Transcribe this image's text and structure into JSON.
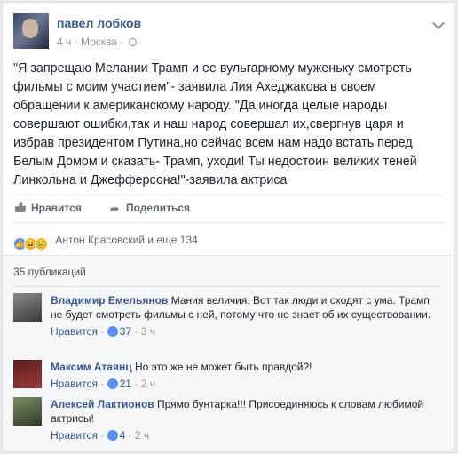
{
  "post": {
    "author": "павел лобков",
    "time": "4 ч",
    "location": "Москва",
    "text": "\"Я запрещаю Мелании Трамп и ее вульгарному муженьку смотреть фильмы с моим участием\"- заявила Лия Ахеджакова в своем обращении к американскому народу. \"Да,иногда целые народы совершают ошибки,так и наш народ совершал их,свергнув царя и избрав президентом Путина,но сейчас всем нам надо встать перед Белым Домом и сказать- Трамп, уходи! Ты недостоин великих теней Линкольна и Джефферсона!\"-заявила актриса"
  },
  "actions": {
    "like": "Нравится",
    "share": "Поделиться"
  },
  "reactions": {
    "text": "Антон Красовский и еще 134",
    "icons": [
      "like-reaction",
      "haha-reaction",
      "sad-reaction"
    ]
  },
  "comments_count": "35 публикаций",
  "comments": [
    {
      "name": "Владимир Емельянов",
      "text": "Мания величия. Вот так люди и сходят с ума. Трамп не будет смотреть фильмы с ней, потому что не знает об их существовании.",
      "like_label": "Нравится",
      "likes": "37",
      "time": "3 ч"
    },
    {
      "name": "Максим Атаянц",
      "text": "Но это же не может быть правдой?!",
      "like_label": "Нравится",
      "likes": "21",
      "time": "2 ч"
    },
    {
      "name": "Алексей Лактионов",
      "text": "Прямо бунтарка!!! Присоединяюсь к словам любимой актрисы!",
      "like_label": "Нравится",
      "likes": "4",
      "time": "2 ч"
    }
  ],
  "colors": {
    "link": "#365899",
    "meta": "#90949c",
    "text": "#1d2129",
    "reaction_like": "#5890ff"
  }
}
